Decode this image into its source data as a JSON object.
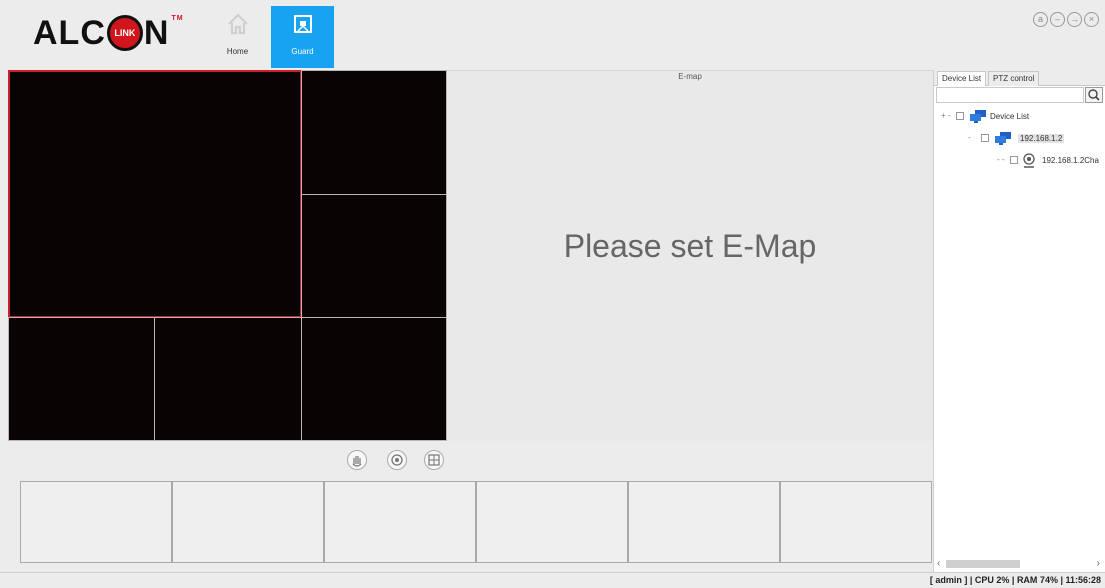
{
  "app": {
    "logo_text_left": "ALC",
    "logo_badge": "LINK",
    "logo_text_right": "N",
    "logo_trademark": "TM"
  },
  "nav": [
    {
      "label": "Home",
      "icon": "home-icon",
      "active": false
    },
    {
      "label": "Guard",
      "icon": "guard-icon",
      "active": true
    }
  ],
  "window_controls": [
    "settings-icon",
    "minimize-icon",
    "logout-icon",
    "close-icon"
  ],
  "emap": {
    "title": "E-map",
    "message": "Please set E-Map"
  },
  "right_panel": {
    "tabs": [
      "Device List",
      "PTZ control"
    ],
    "search": {
      "placeholder": "",
      "value": ""
    },
    "tree": [
      {
        "label": "Device List",
        "level": 0,
        "icon": "device-group-icon"
      },
      {
        "label": "192.168.1.2",
        "level": 1,
        "icon": "device-group-icon",
        "selected": true
      },
      {
        "label": "192.168.1.2Cha",
        "level": 2,
        "icon": "camera-icon"
      }
    ]
  },
  "toolbar": {
    "buttons": [
      "hand-icon",
      "record-icon",
      "layout-icon"
    ]
  },
  "status": {
    "text": "[ admin ] | CPU  2% | RAM  74% | 11:56:28"
  },
  "colors": {
    "accent": "#17a3f0",
    "active_border": "#c8212a",
    "video_bg": "#0a0303",
    "logo_red": "#d0151c"
  }
}
